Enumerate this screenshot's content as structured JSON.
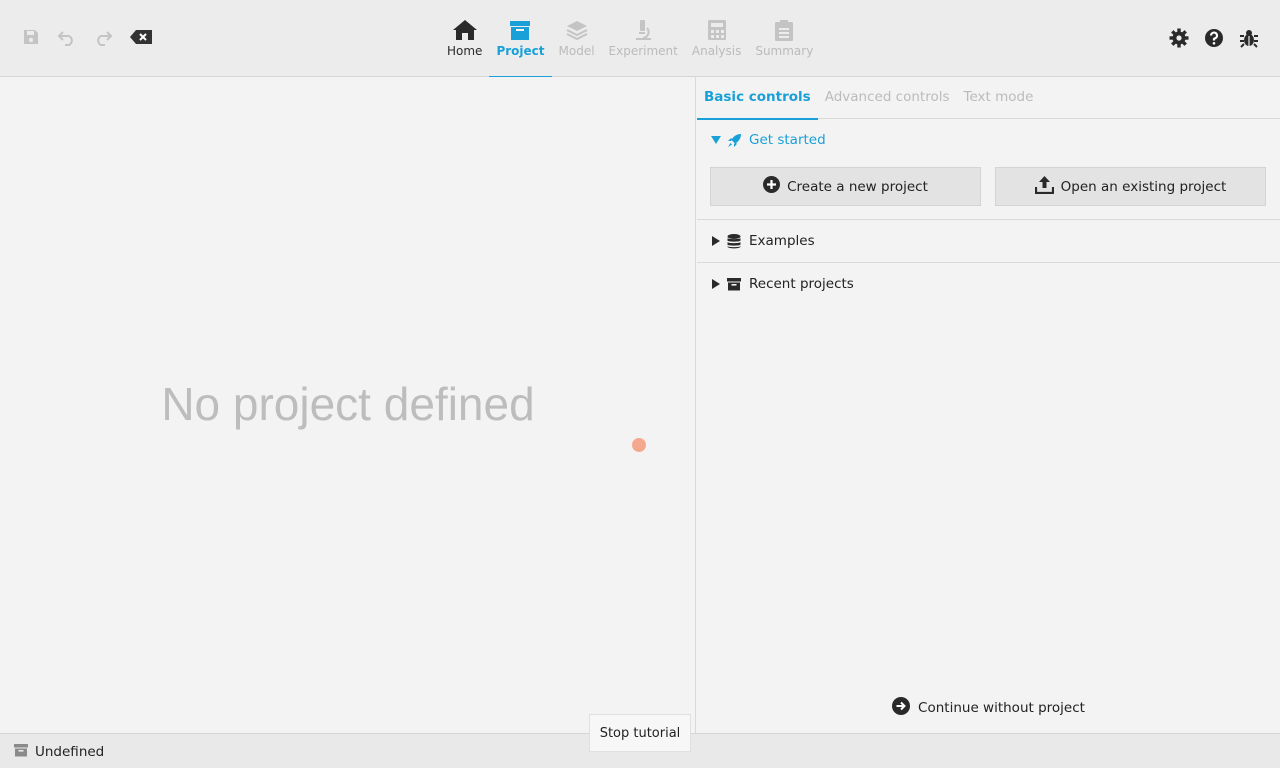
{
  "toolbar": {
    "left_icons": [
      "save-icon",
      "undo-icon",
      "redo-icon",
      "clear-icon"
    ],
    "right_icons": [
      "settings-icon",
      "help-icon",
      "bug-report-icon"
    ]
  },
  "nav": {
    "tabs": [
      {
        "label": "Home",
        "icon": "home-icon",
        "state": "enabled"
      },
      {
        "label": "Project",
        "icon": "project-box-icon",
        "state": "active"
      },
      {
        "label": "Model",
        "icon": "layers-icon",
        "state": "disabled"
      },
      {
        "label": "Experiment",
        "icon": "microscope-icon",
        "state": "disabled"
      },
      {
        "label": "Analysis",
        "icon": "calculator-icon",
        "state": "disabled"
      },
      {
        "label": "Summary",
        "icon": "clipboard-icon",
        "state": "disabled"
      }
    ]
  },
  "left": {
    "empty_message": "No project defined"
  },
  "right": {
    "tabs": [
      {
        "label": "Basic controls",
        "active": true
      },
      {
        "label": "Advanced controls",
        "active": false
      },
      {
        "label": "Text mode",
        "active": false
      }
    ],
    "sections": {
      "get_started": {
        "label": "Get started",
        "expanded": true
      },
      "examples": {
        "label": "Examples",
        "expanded": false
      },
      "recent": {
        "label": "Recent projects",
        "expanded": false
      }
    },
    "buttons": {
      "create": "Create a new project",
      "open": "Open an existing project"
    },
    "continue_label": "Continue without project"
  },
  "status": {
    "project_label": "Undefined"
  },
  "tutorial": {
    "stop_label": "Stop tutorial"
  },
  "colors": {
    "accent": "#1aa0d8",
    "disabled": "#bbbbbb",
    "cursor": "#f4a98e"
  }
}
